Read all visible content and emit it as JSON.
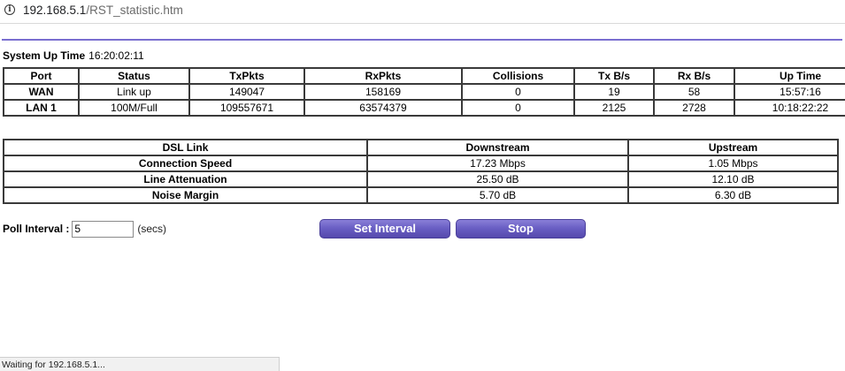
{
  "browser": {
    "url_host": "192.168.5.1",
    "url_path": "/RST_statistic.htm",
    "status": "Waiting for 192.168.5.1..."
  },
  "system": {
    "up_time_label": "System Up Time",
    "up_time_value": "16:20:02:11"
  },
  "port_table": {
    "headers": [
      "Port",
      "Status",
      "TxPkts",
      "RxPkts",
      "Collisions",
      "Tx B/s",
      "Rx B/s",
      "Up Time"
    ],
    "rows": [
      [
        "WAN",
        "Link up",
        "149047",
        "158169",
        "0",
        "19",
        "58",
        "15:57:16"
      ],
      [
        "LAN 1",
        "100M/Full",
        "109557671",
        "63574379",
        "0",
        "2125",
        "2728",
        "10:18:22:22"
      ]
    ]
  },
  "dsl_table": {
    "headers": [
      "DSL Link",
      "Downstream",
      "Upstream"
    ],
    "rows": [
      [
        "Connection Speed",
        "17.23 Mbps",
        "1.05 Mbps"
      ],
      [
        "Line Attenuation",
        "25.50 dB",
        "12.10 dB"
      ],
      [
        "Noise Margin",
        "5.70 dB",
        "6.30 dB"
      ]
    ]
  },
  "poll": {
    "label": "Poll Interval :",
    "value": "5",
    "unit": "(secs)"
  },
  "buttons": {
    "set_interval": "Set Interval",
    "stop": "Stop"
  },
  "icons": {
    "site_info": "info-icon"
  },
  "colors": {
    "accent_rule": "#7a6fd0",
    "button": "#6a5fc4"
  }
}
